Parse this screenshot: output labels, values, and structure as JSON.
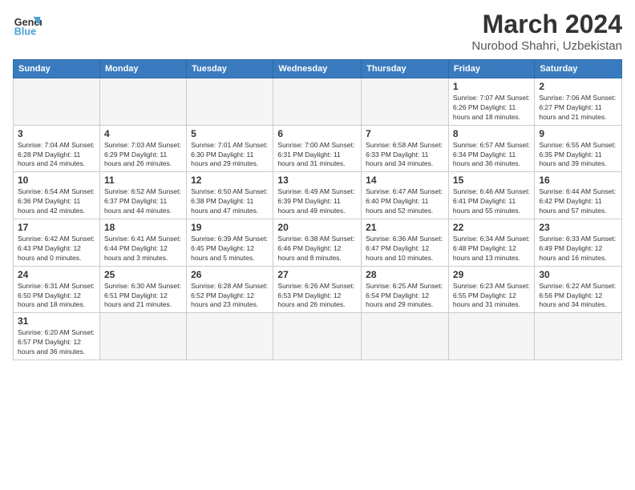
{
  "logo": {
    "text_general": "General",
    "text_blue": "Blue"
  },
  "title": "March 2024",
  "subtitle": "Nurobod Shahri, Uzbekistan",
  "weekdays": [
    "Sunday",
    "Monday",
    "Tuesday",
    "Wednesday",
    "Thursday",
    "Friday",
    "Saturday"
  ],
  "weeks": [
    [
      {
        "day": "",
        "info": ""
      },
      {
        "day": "",
        "info": ""
      },
      {
        "day": "",
        "info": ""
      },
      {
        "day": "",
        "info": ""
      },
      {
        "day": "",
        "info": ""
      },
      {
        "day": "1",
        "info": "Sunrise: 7:07 AM\nSunset: 6:26 PM\nDaylight: 11 hours and 18 minutes."
      },
      {
        "day": "2",
        "info": "Sunrise: 7:06 AM\nSunset: 6:27 PM\nDaylight: 11 hours and 21 minutes."
      }
    ],
    [
      {
        "day": "3",
        "info": "Sunrise: 7:04 AM\nSunset: 6:28 PM\nDaylight: 11 hours and 24 minutes."
      },
      {
        "day": "4",
        "info": "Sunrise: 7:03 AM\nSunset: 6:29 PM\nDaylight: 11 hours and 26 minutes."
      },
      {
        "day": "5",
        "info": "Sunrise: 7:01 AM\nSunset: 6:30 PM\nDaylight: 11 hours and 29 minutes."
      },
      {
        "day": "6",
        "info": "Sunrise: 7:00 AM\nSunset: 6:31 PM\nDaylight: 11 hours and 31 minutes."
      },
      {
        "day": "7",
        "info": "Sunrise: 6:58 AM\nSunset: 6:33 PM\nDaylight: 11 hours and 34 minutes."
      },
      {
        "day": "8",
        "info": "Sunrise: 6:57 AM\nSunset: 6:34 PM\nDaylight: 11 hours and 36 minutes."
      },
      {
        "day": "9",
        "info": "Sunrise: 6:55 AM\nSunset: 6:35 PM\nDaylight: 11 hours and 39 minutes."
      }
    ],
    [
      {
        "day": "10",
        "info": "Sunrise: 6:54 AM\nSunset: 6:36 PM\nDaylight: 11 hours and 42 minutes."
      },
      {
        "day": "11",
        "info": "Sunrise: 6:52 AM\nSunset: 6:37 PM\nDaylight: 11 hours and 44 minutes."
      },
      {
        "day": "12",
        "info": "Sunrise: 6:50 AM\nSunset: 6:38 PM\nDaylight: 11 hours and 47 minutes."
      },
      {
        "day": "13",
        "info": "Sunrise: 6:49 AM\nSunset: 6:39 PM\nDaylight: 11 hours and 49 minutes."
      },
      {
        "day": "14",
        "info": "Sunrise: 6:47 AM\nSunset: 6:40 PM\nDaylight: 11 hours and 52 minutes."
      },
      {
        "day": "15",
        "info": "Sunrise: 6:46 AM\nSunset: 6:41 PM\nDaylight: 11 hours and 55 minutes."
      },
      {
        "day": "16",
        "info": "Sunrise: 6:44 AM\nSunset: 6:42 PM\nDaylight: 11 hours and 57 minutes."
      }
    ],
    [
      {
        "day": "17",
        "info": "Sunrise: 6:42 AM\nSunset: 6:43 PM\nDaylight: 12 hours and 0 minutes."
      },
      {
        "day": "18",
        "info": "Sunrise: 6:41 AM\nSunset: 6:44 PM\nDaylight: 12 hours and 3 minutes."
      },
      {
        "day": "19",
        "info": "Sunrise: 6:39 AM\nSunset: 6:45 PM\nDaylight: 12 hours and 5 minutes."
      },
      {
        "day": "20",
        "info": "Sunrise: 6:38 AM\nSunset: 6:46 PM\nDaylight: 12 hours and 8 minutes."
      },
      {
        "day": "21",
        "info": "Sunrise: 6:36 AM\nSunset: 6:47 PM\nDaylight: 12 hours and 10 minutes."
      },
      {
        "day": "22",
        "info": "Sunrise: 6:34 AM\nSunset: 6:48 PM\nDaylight: 12 hours and 13 minutes."
      },
      {
        "day": "23",
        "info": "Sunrise: 6:33 AM\nSunset: 6:49 PM\nDaylight: 12 hours and 16 minutes."
      }
    ],
    [
      {
        "day": "24",
        "info": "Sunrise: 6:31 AM\nSunset: 6:50 PM\nDaylight: 12 hours and 18 minutes."
      },
      {
        "day": "25",
        "info": "Sunrise: 6:30 AM\nSunset: 6:51 PM\nDaylight: 12 hours and 21 minutes."
      },
      {
        "day": "26",
        "info": "Sunrise: 6:28 AM\nSunset: 6:52 PM\nDaylight: 12 hours and 23 minutes."
      },
      {
        "day": "27",
        "info": "Sunrise: 6:26 AM\nSunset: 6:53 PM\nDaylight: 12 hours and 26 minutes."
      },
      {
        "day": "28",
        "info": "Sunrise: 6:25 AM\nSunset: 6:54 PM\nDaylight: 12 hours and 29 minutes."
      },
      {
        "day": "29",
        "info": "Sunrise: 6:23 AM\nSunset: 6:55 PM\nDaylight: 12 hours and 31 minutes."
      },
      {
        "day": "30",
        "info": "Sunrise: 6:22 AM\nSunset: 6:56 PM\nDaylight: 12 hours and 34 minutes."
      }
    ],
    [
      {
        "day": "31",
        "info": "Sunrise: 6:20 AM\nSunset: 6:57 PM\nDaylight: 12 hours and 36 minutes."
      },
      {
        "day": "",
        "info": ""
      },
      {
        "day": "",
        "info": ""
      },
      {
        "day": "",
        "info": ""
      },
      {
        "day": "",
        "info": ""
      },
      {
        "day": "",
        "info": ""
      },
      {
        "day": "",
        "info": ""
      }
    ]
  ]
}
